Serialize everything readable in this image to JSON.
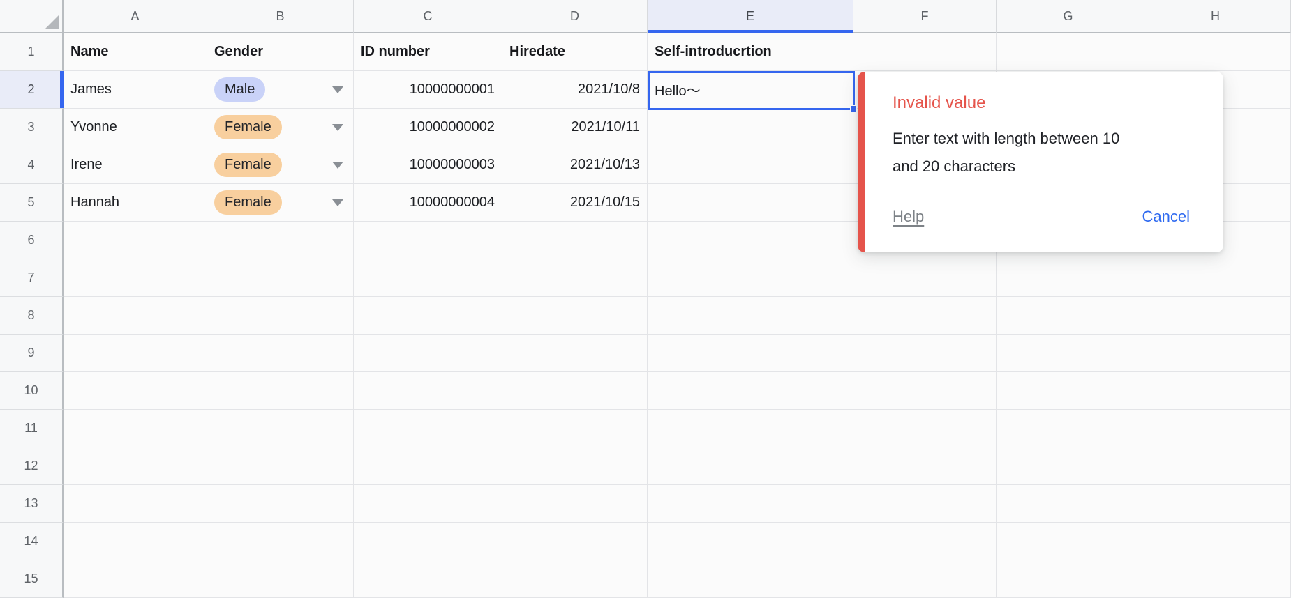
{
  "sheet": {
    "column_letters": [
      "A",
      "B",
      "C",
      "D",
      "E",
      "F",
      "G",
      "H"
    ],
    "visible_row_count": 15,
    "selected_column": "E",
    "selected_row_number": "2",
    "selected_cell_ref": "E2",
    "header_row": [
      "Name",
      "Gender",
      "ID number",
      "Hiredate",
      "Self-introducrtion"
    ],
    "records": [
      {
        "name": "James",
        "gender": "Male",
        "gender_color": "blue",
        "id_number": "10000000001",
        "hiredate": "2021/10/8",
        "self_introduction": "Hello～"
      },
      {
        "name": "Yvonne",
        "gender": "Female",
        "gender_color": "orange",
        "id_number": "10000000002",
        "hiredate": "2021/10/11",
        "self_introduction": ""
      },
      {
        "name": "Irene",
        "gender": "Female",
        "gender_color": "orange",
        "id_number": "10000000003",
        "hiredate": "2021/10/13",
        "self_introduction": ""
      },
      {
        "name": "Hannah",
        "gender": "Female",
        "gender_color": "orange",
        "id_number": "10000000004",
        "hiredate": "2021/10/15",
        "self_introduction": ""
      }
    ]
  },
  "validation_popup": {
    "title": "Invalid value",
    "message": "Enter text with length between 10 and 20 characters",
    "message_lines": [
      "Enter text with length between 10",
      "and 20 characters"
    ],
    "help_label": "Help",
    "cancel_label": "Cancel"
  },
  "colors": {
    "selection_blue": "#3566ef",
    "male_chip_bg": "#c9d2f8",
    "female_chip_bg": "#f8cf9e",
    "error_red": "#e5544b",
    "cancel_link_blue": "#2f6af0",
    "help_link_gray": "#7d8287",
    "header_bg": "#f7f8f9",
    "selected_header_bg": "#e9ecf8",
    "gridline": "#e3e4e7"
  }
}
